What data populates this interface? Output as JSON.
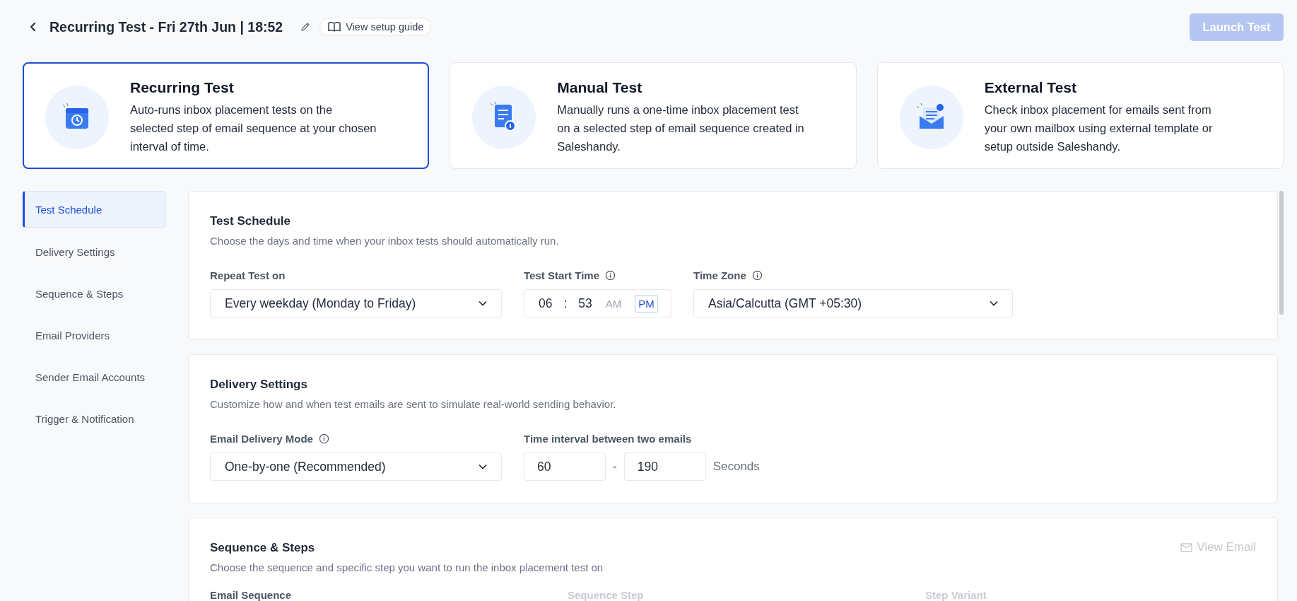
{
  "header": {
    "title": "Recurring Test - Fri 27th Jun | 18:52",
    "guide_button": "View setup guide",
    "launch_button": {
      "label": "Launch Test",
      "disabled": true
    }
  },
  "test_types": [
    {
      "kind": "recurring",
      "title": "Recurring Test",
      "description": "Auto-runs inbox placement tests on the selected step of email sequence at your chosen interval of time.",
      "selected": true
    },
    {
      "kind": "manual",
      "title": "Manual Test",
      "description": "Manually runs a one-time inbox placement test on a selected step of email sequence created in Saleshandy.",
      "selected": false
    },
    {
      "kind": "external",
      "title": "External Test",
      "description": "Check inbox placement for emails sent from your own mailbox using external template or setup outside Saleshandy.",
      "selected": false
    }
  ],
  "sidebar": {
    "items": [
      {
        "label": "Test Schedule",
        "selected": true
      },
      {
        "label": "Delivery Settings",
        "selected": false
      },
      {
        "label": "Sequence & Steps",
        "selected": false
      },
      {
        "label": "Email Providers",
        "selected": false
      },
      {
        "label": "Sender Email Accounts",
        "selected": false
      },
      {
        "label": "Trigger & Notification",
        "selected": false
      }
    ]
  },
  "test_schedule": {
    "title": "Test Schedule",
    "description": "Choose the days and time when your inbox tests should automatically run.",
    "repeat": {
      "label": "Repeat Test on",
      "info": false,
      "value": "Every weekday (Monday to Friday)"
    },
    "start_time": {
      "label": "Test Start Time",
      "info": true,
      "hour": "06",
      "separator": ":",
      "minute": "53",
      "periods": [
        {
          "label": "AM",
          "selected": false
        },
        {
          "label": "PM",
          "selected": true
        }
      ]
    },
    "time_zone": {
      "label": "Time Zone",
      "info": true,
      "value": "Asia/Calcutta (GMT +05:30)"
    }
  },
  "delivery_settings": {
    "title": "Delivery Settings",
    "description": "Customize how and when test emails are sent to simulate real-world sending behavior.",
    "mode": {
      "label": "Email Delivery Mode",
      "info": true,
      "value": "One-by-one (Recommended)"
    },
    "interval": {
      "label": "Time interval between two emails",
      "min": "60",
      "separator": "-",
      "max": "190",
      "unit": "Seconds"
    }
  },
  "sequence_steps": {
    "title": "Sequence & Steps",
    "description": "Choose the sequence and specific step you want to run the inbox placement test on",
    "view_email": {
      "label": "View Email",
      "disabled": true
    },
    "fields": [
      {
        "label": "Email Sequence",
        "disabled": false
      },
      {
        "label": "Sequence Step",
        "disabled": true
      },
      {
        "label": "Step Variant",
        "disabled": true
      }
    ]
  }
}
